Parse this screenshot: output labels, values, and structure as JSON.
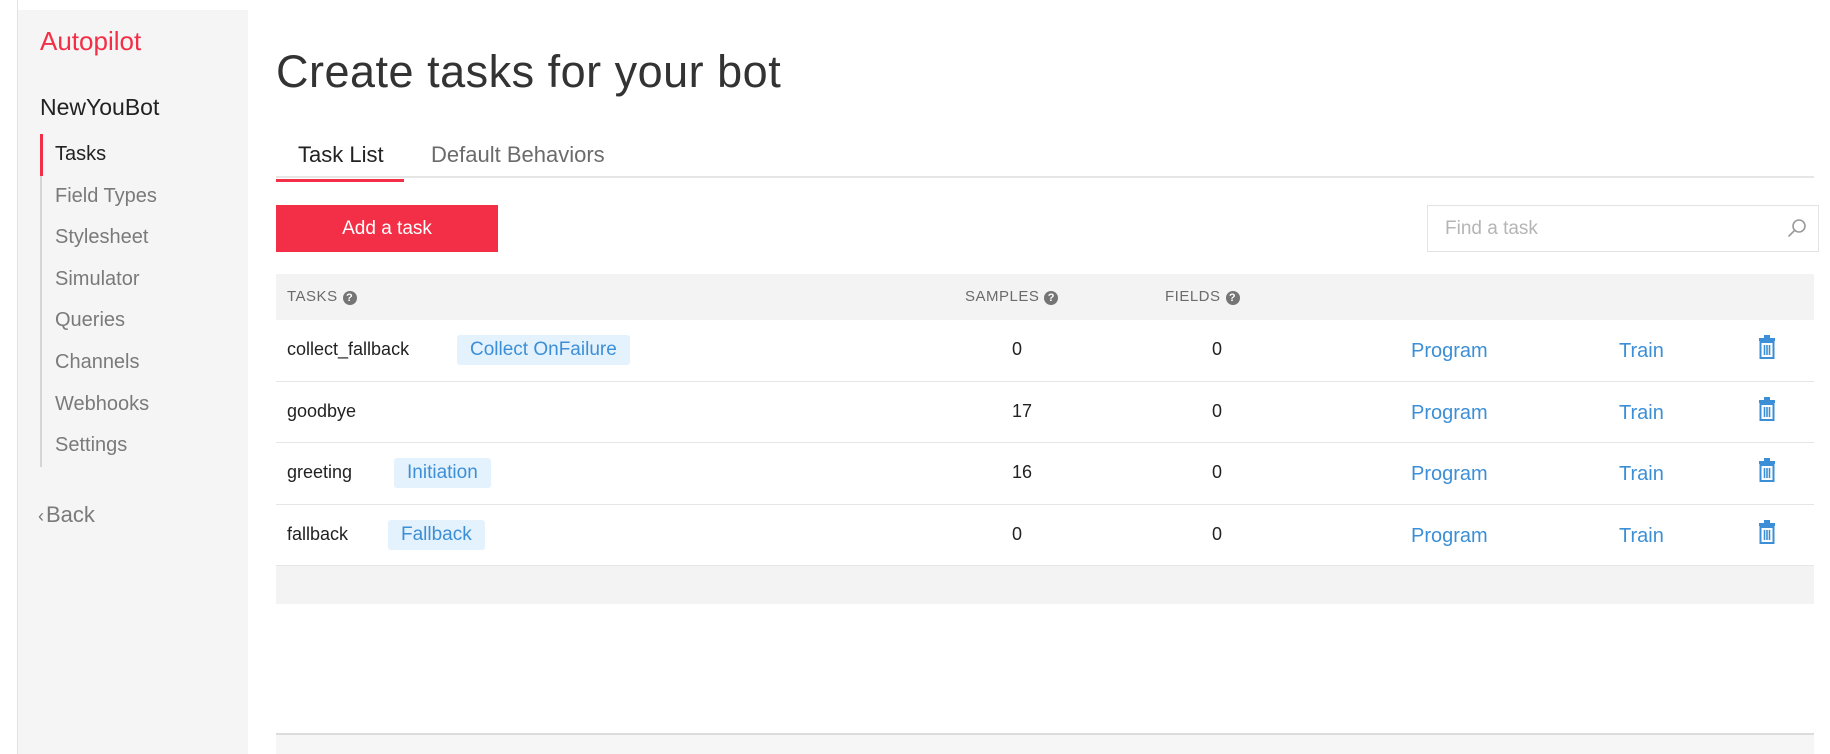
{
  "sidebar": {
    "brand": "Autopilot",
    "bot_name": "NewYouBot",
    "items": [
      {
        "label": "Tasks"
      },
      {
        "label": "Field Types"
      },
      {
        "label": "Stylesheet"
      },
      {
        "label": "Simulator"
      },
      {
        "label": "Queries"
      },
      {
        "label": "Channels"
      },
      {
        "label": "Webhooks"
      },
      {
        "label": "Settings"
      }
    ],
    "active_item": "Tasks",
    "back_chevron": "‹",
    "back_label": "Back"
  },
  "main": {
    "title": "Create tasks for your bot",
    "tabs": [
      {
        "label": "Task List"
      },
      {
        "label": "Default Behaviors"
      }
    ],
    "active_tab": "Task List",
    "add_button_label": "Add a task",
    "search": {
      "placeholder": "Find a task",
      "value": ""
    },
    "table": {
      "columns": {
        "tasks": "TASKS",
        "samples": "SAMPLES",
        "fields": "FIELDS"
      },
      "help_glyph": "?",
      "program_label": "Program",
      "train_label": "Train",
      "rows": [
        {
          "name": "collect_fallback",
          "badge": "Collect OnFailure",
          "samples": "0",
          "fields": "0"
        },
        {
          "name": "goodbye",
          "badge": "",
          "samples": "17",
          "fields": "0"
        },
        {
          "name": "greeting",
          "badge": "Initiation",
          "samples": "16",
          "fields": "0"
        },
        {
          "name": "fallback",
          "badge": "Fallback",
          "samples": "0",
          "fields": "0"
        }
      ]
    }
  },
  "colors": {
    "accent": "#f22f46",
    "link": "#3c8fd6",
    "badge_bg": "#e4f2fd",
    "sidebar_bg": "#f5f5f5",
    "header_bg": "#f3f3f3"
  },
  "icons": {
    "search": "search-icon",
    "trash": "trash-icon",
    "help": "help-icon",
    "back": "chevron-left-icon"
  }
}
